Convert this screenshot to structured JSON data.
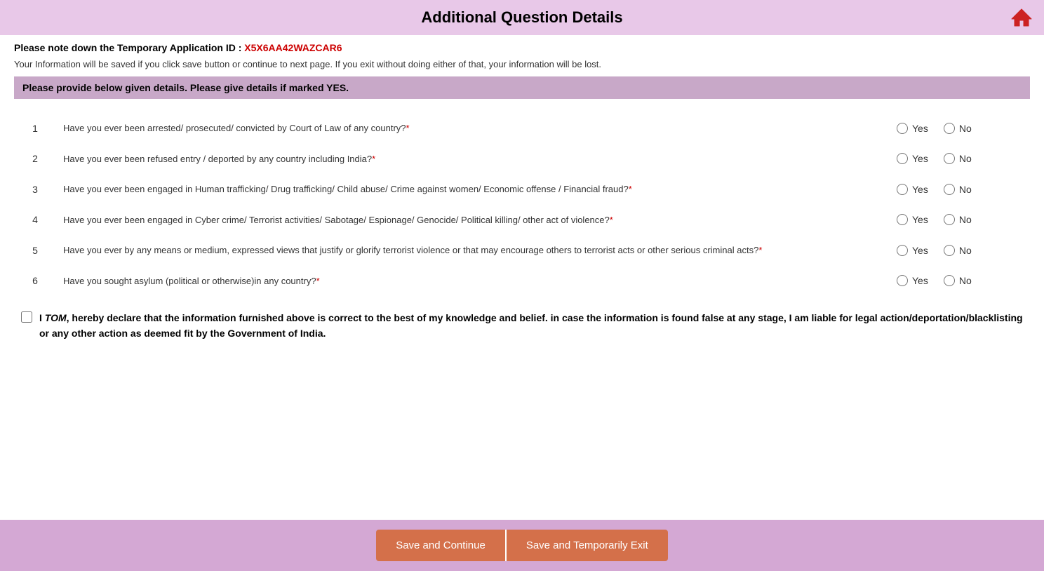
{
  "header": {
    "title": "Additional Question Details",
    "home_icon": "home"
  },
  "temp_id": {
    "label": "Please note down the Temporary Application ID :",
    "value": "X5X6AA42WAZCAR6"
  },
  "info_text": "Your Information will be saved if you click save button or continue to next page. If you exit without doing either of that, your information will be lost.",
  "section_header": "Please provide below given details. Please give details if marked YES.",
  "questions": [
    {
      "num": "1",
      "text": "Have you ever been arrested/ prosecuted/ convicted by Court of Law of any country?",
      "required": true
    },
    {
      "num": "2",
      "text": "Have you ever been refused entry / deported by any country including India?",
      "required": true
    },
    {
      "num": "3",
      "text": "Have you ever been engaged in Human trafficking/ Drug trafficking/ Child abuse/ Crime against women/ Economic offense / Financial fraud?",
      "required": true
    },
    {
      "num": "4",
      "text": "Have you ever been engaged in Cyber crime/ Terrorist activities/ Sabotage/ Espionage/ Genocide/ Political killing/ other act of violence?",
      "required": true
    },
    {
      "num": "5",
      "text": "Have you ever by any means or medium, expressed views that justify or glorify terrorist violence or that may encourage others to terrorist acts or other serious criminal acts?",
      "required": true
    },
    {
      "num": "6",
      "text": "Have you sought asylum (political or otherwise)in any country?",
      "required": true
    }
  ],
  "options": {
    "yes": "Yes",
    "no": "No"
  },
  "declaration": {
    "name": "TOM",
    "text_before": "I ",
    "text_after": ", hereby declare that the information furnished above is correct to the best of my knowledge and belief. in case the information is found false at any stage, I am liable for legal action/deportation/blacklisting or any other action as deemed fit by the Government of India."
  },
  "buttons": {
    "save_continue": "Save and Continue",
    "save_exit": "Save and Temporarily Exit"
  }
}
